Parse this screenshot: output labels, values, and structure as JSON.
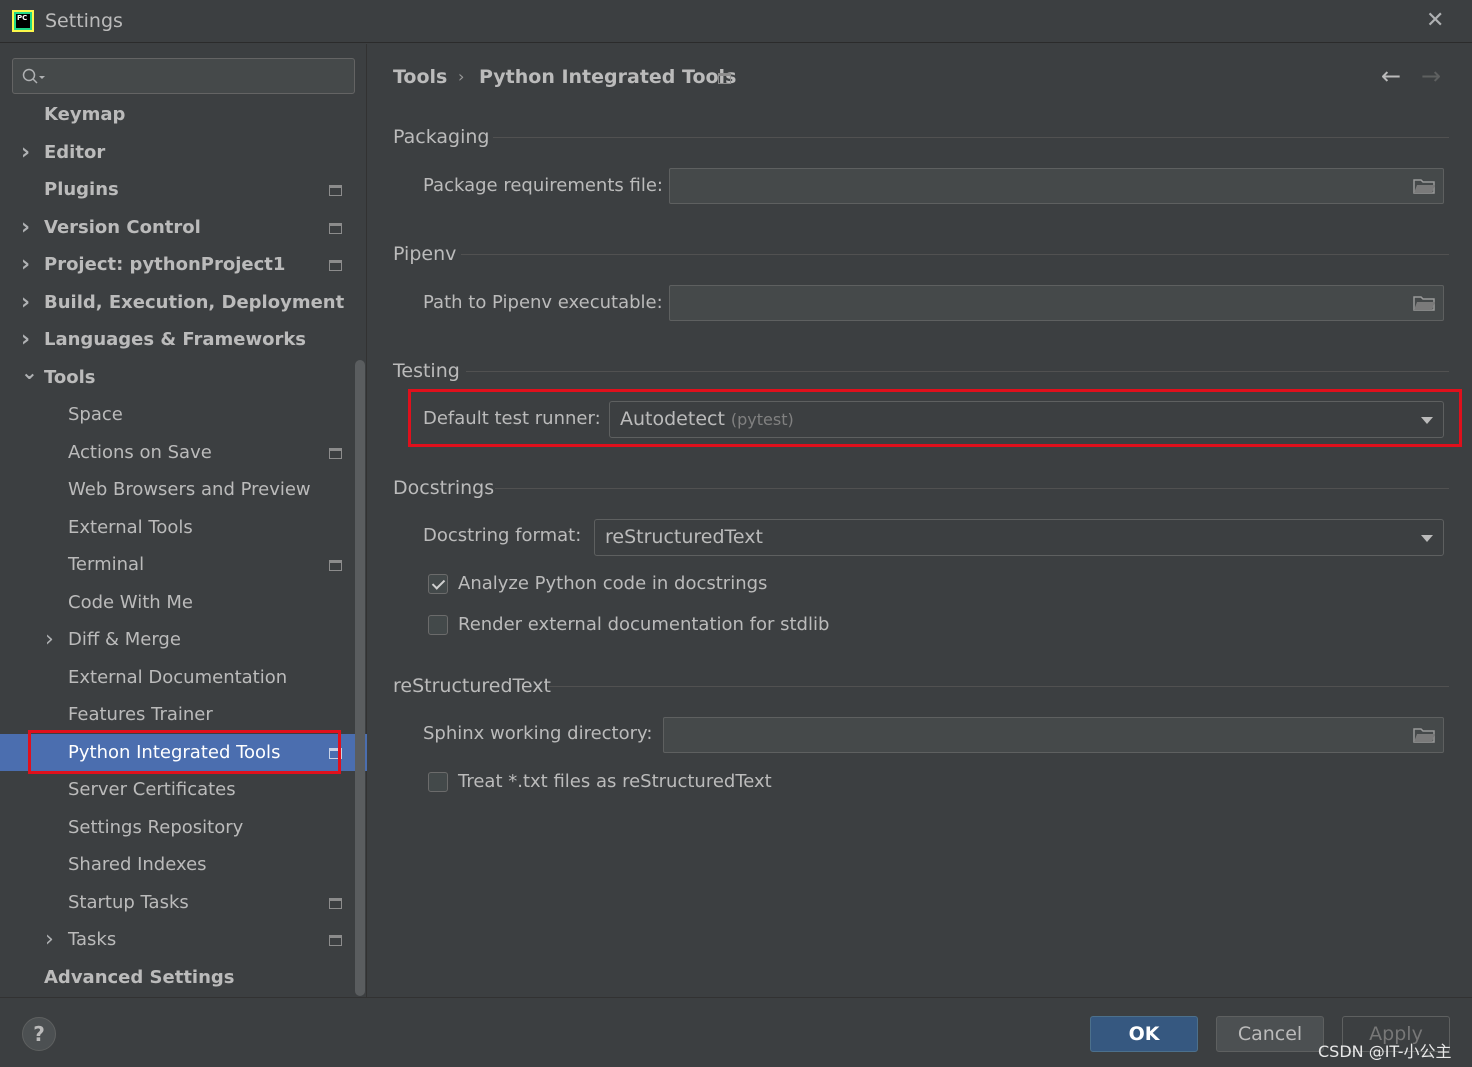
{
  "window": {
    "title": "Settings",
    "app_icon_text": "PC"
  },
  "search": {
    "placeholder": ""
  },
  "sidebar": {
    "items": [
      {
        "label": "Keymap",
        "level": 0,
        "bold": true,
        "arrow": "",
        "icon": false
      },
      {
        "label": "Editor",
        "level": 0,
        "bold": true,
        "arrow": ">",
        "icon": false
      },
      {
        "label": "Plugins",
        "level": 0,
        "bold": true,
        "arrow": "",
        "icon": true
      },
      {
        "label": "Version Control",
        "level": 0,
        "bold": true,
        "arrow": ">",
        "icon": true
      },
      {
        "label": "Project: pythonProject1",
        "level": 0,
        "bold": true,
        "arrow": ">",
        "icon": true
      },
      {
        "label": "Build, Execution, Deployment",
        "level": 0,
        "bold": true,
        "arrow": ">",
        "icon": false
      },
      {
        "label": "Languages & Frameworks",
        "level": 0,
        "bold": true,
        "arrow": ">",
        "icon": false
      },
      {
        "label": "Tools",
        "level": 0,
        "bold": true,
        "arrow": "v",
        "icon": false
      },
      {
        "label": "Space",
        "level": 1,
        "bold": false,
        "arrow": "",
        "icon": false
      },
      {
        "label": "Actions on Save",
        "level": 1,
        "bold": false,
        "arrow": "",
        "icon": true
      },
      {
        "label": "Web Browsers and Preview",
        "level": 1,
        "bold": false,
        "arrow": "",
        "icon": false
      },
      {
        "label": "External Tools",
        "level": 1,
        "bold": false,
        "arrow": "",
        "icon": false
      },
      {
        "label": "Terminal",
        "level": 1,
        "bold": false,
        "arrow": "",
        "icon": true
      },
      {
        "label": "Code With Me",
        "level": 1,
        "bold": false,
        "arrow": "",
        "icon": false
      },
      {
        "label": "Diff & Merge",
        "level": 1,
        "bold": false,
        "arrow": ">",
        "icon": false
      },
      {
        "label": "External Documentation",
        "level": 1,
        "bold": false,
        "arrow": "",
        "icon": false
      },
      {
        "label": "Features Trainer",
        "level": 1,
        "bold": false,
        "arrow": "",
        "icon": false
      },
      {
        "label": "Python Integrated Tools",
        "level": 1,
        "bold": false,
        "arrow": "",
        "icon": true,
        "selected": true
      },
      {
        "label": "Server Certificates",
        "level": 1,
        "bold": false,
        "arrow": "",
        "icon": false
      },
      {
        "label": "Settings Repository",
        "level": 1,
        "bold": false,
        "arrow": "",
        "icon": false
      },
      {
        "label": "Shared Indexes",
        "level": 1,
        "bold": false,
        "arrow": "",
        "icon": false
      },
      {
        "label": "Startup Tasks",
        "level": 1,
        "bold": false,
        "arrow": "",
        "icon": true
      },
      {
        "label": "Tasks",
        "level": 1,
        "bold": false,
        "arrow": ">",
        "icon": true
      },
      {
        "label": "Advanced Settings",
        "level": 0,
        "bold": true,
        "arrow": "",
        "icon": false
      }
    ]
  },
  "breadcrumb": {
    "parent": "Tools",
    "separator": "›",
    "current": "Python Integrated Tools"
  },
  "packaging": {
    "section": "Packaging",
    "req_label": "Package requirements file:",
    "req_value": ""
  },
  "pipenv": {
    "section": "Pipenv",
    "path_label": "Path to Pipenv executable:",
    "path_value": ""
  },
  "testing": {
    "section": "Testing",
    "runner_label": "Default test runner:",
    "runner_value": "Autodetect",
    "runner_hint": "(pytest)"
  },
  "docstrings": {
    "section": "Docstrings",
    "format_label": "Docstring format:",
    "format_value": "reStructuredText",
    "analyze_label": "Analyze Python code in docstrings",
    "analyze_checked": true,
    "render_label": "Render external documentation for stdlib",
    "render_checked": false
  },
  "rest": {
    "section": "reStructuredText",
    "sphinx_label": "Sphinx working directory:",
    "sphinx_value": "",
    "txt_label": "Treat *.txt files as reStructuredText",
    "txt_checked": false
  },
  "footer": {
    "help": "?",
    "ok": "OK",
    "cancel": "Cancel",
    "apply": "Apply"
  },
  "watermark": "CSDN @IT-小公主",
  "colors": {
    "selection": "#4b6eaf",
    "highlight_box": "#e0101c",
    "ok_button": "#365880"
  }
}
